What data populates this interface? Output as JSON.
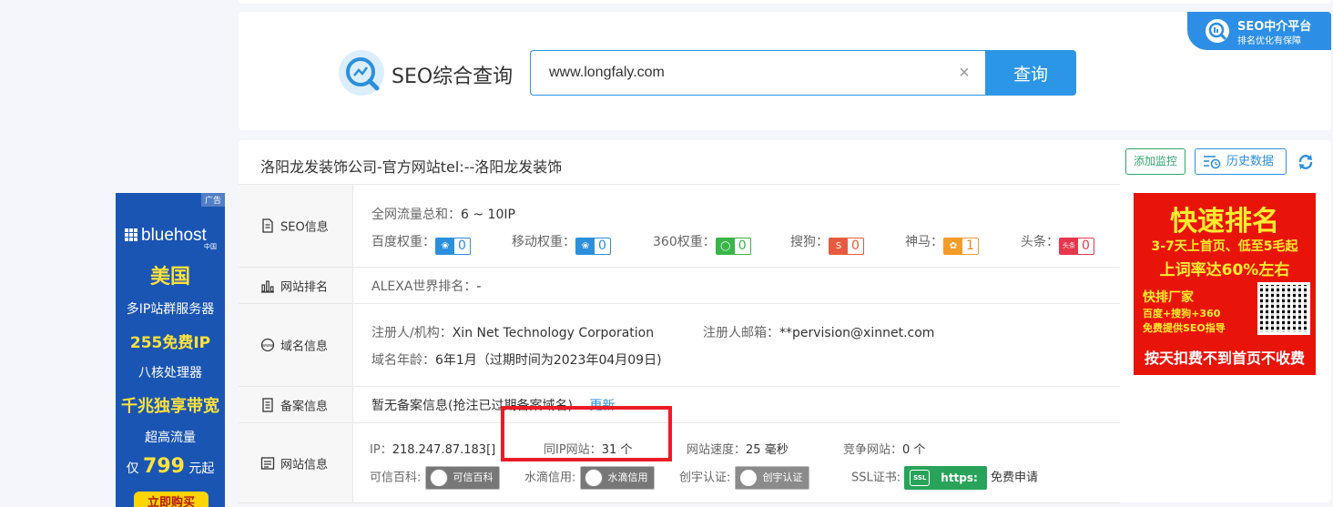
{
  "search": {
    "title": "SEO综合查询",
    "query": "www.longfaly.com",
    "clear_glyph": "×",
    "button_label": "查询"
  },
  "promo_badge": {
    "line1": "SEO中介平台",
    "line2": "排名优化有保障"
  },
  "left_ad": {
    "tag": "广告",
    "brand": "bluehost",
    "brand_sub": "中国",
    "lines": [
      "美国",
      "多IP站群服务器",
      "255免费IP",
      "八核处理器",
      "千兆独享带宽",
      "超高流量"
    ],
    "price_prefix": "仅",
    "price": "799",
    "price_suffix": "元起",
    "buy_label": "立即购买"
  },
  "site": {
    "title": "洛阳龙发装饰公司-官方网站tel:--洛阳龙发装饰",
    "monitor_label": "添加监控",
    "history_label": "历史数据"
  },
  "seo_row": {
    "head": "SEO信息",
    "traffic_label": "全网流量总和：",
    "traffic_value": "6 ~ 10IP",
    "weights": [
      {
        "label": "百度权重：",
        "value": "0",
        "color": "blue",
        "icon": "baidu-paw-icon"
      },
      {
        "label": "移动权重：",
        "value": "0",
        "color": "blue",
        "icon": "mobile-paw-icon"
      },
      {
        "label": "360权重：",
        "value": "0",
        "color": "green",
        "icon": "360-icon"
      },
      {
        "label": "搜狗：",
        "value": "0",
        "color": "red",
        "icon": "sogou-icon"
      },
      {
        "label": "神马：",
        "value": "1",
        "color": "orange",
        "icon": "shenma-icon"
      },
      {
        "label": "头条：",
        "value": "0",
        "color": "pink",
        "icon": "toutiao-icon",
        "icon_text": "头条"
      }
    ]
  },
  "rank_row": {
    "head": "网站排名",
    "alexa_label": "ALEXA世界排名：",
    "alexa_value": "-"
  },
  "domain_row": {
    "head": "域名信息",
    "registrar_label": "注册人/机构：",
    "registrar_value": "Xin Net Technology Corporation",
    "email_label": "注册人邮箱：",
    "email_value": "**pervision@xinnet.com",
    "age_label": "域名年龄：",
    "age_value": "6年1月（过期时间为2023年04月09日)"
  },
  "icp_row": {
    "head": "备案信息",
    "text": "暂无备案信息(抢注已过期备案域名)",
    "update_label": "更新"
  },
  "site_row": {
    "head": "网站信息",
    "ip_label": "IP：",
    "ip_value": "218.247.87.183[]",
    "same_ip_label": "同IP网站：",
    "same_ip_value": "31 个",
    "speed_label": "网站速度：",
    "speed_value": "25 毫秒",
    "compete_label": "竞争网站：",
    "compete_value": "0 个",
    "credible_label": "可信百科:",
    "credible_badge": "可信百科",
    "water_label": "水滴信用:",
    "water_badge": "水滴信用",
    "chuangyu_label": "创宇认证:",
    "chuangyu_badge": "创宇认证",
    "ssl_label": "SSL证书:",
    "ssl_icon_text": "SSL",
    "ssl_badge": "https:",
    "ssl_free": "免费申请"
  },
  "right_ad": {
    "title": "快速排名",
    "line2": "3-7天上首页、低至5毛起",
    "line3": "上词率达60%左右",
    "line4": "快排厂家",
    "line5": "百度+搜狗+360",
    "line6": "免费提供SEO指导",
    "bottom": "按天扣费不到首页不收费"
  },
  "colors": {
    "accent": "#2c96e6",
    "highlight": "#ea1b25",
    "ad_red": "#e8140a",
    "ad_blue": "#1a55b3"
  }
}
